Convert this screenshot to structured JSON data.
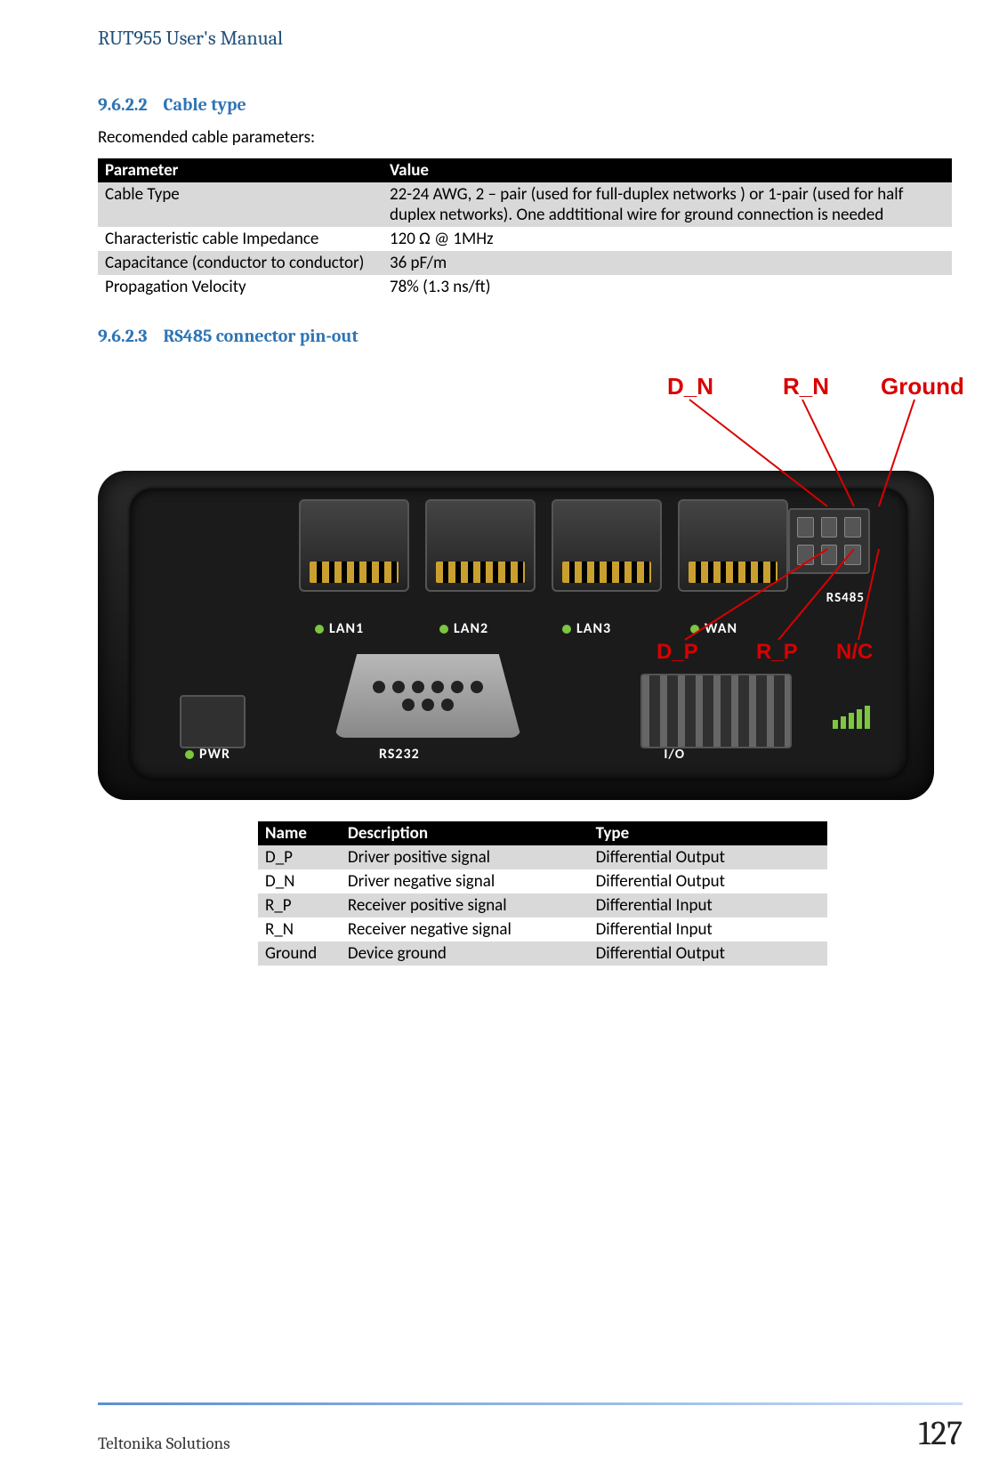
{
  "header": {
    "title": "RUT955 User's Manual"
  },
  "section1": {
    "number": "9.6.2.2",
    "title": "Cable type",
    "intro": "Recomended cable parameters:",
    "table": {
      "headers": [
        "Parameter",
        "Value"
      ],
      "rows": [
        {
          "p": "Cable Type",
          "v": "22-24 AWG, 2 – pair (used for full-duplex networks ) or 1-pair (used for half duplex networks). One addtitional wire for ground connection is needed"
        },
        {
          "p": "Characteristic cable Impedance",
          "v": "120 Ω @ 1MHz"
        },
        {
          "p": "Capacitance (conductor to conductor)",
          "v": "36 pF/m"
        },
        {
          "p": "Propagation Velocity",
          "v": "78% (1.3 ns/ft)"
        }
      ]
    }
  },
  "section2": {
    "number": "9.6.2.3",
    "title": "RS485 connector pin-out",
    "deviceLabels": {
      "lan1": "LAN1",
      "lan2": "LAN2",
      "lan3": "LAN3",
      "wan": "WAN",
      "rs485": "RS485",
      "pwr": "PWR",
      "rs232": "RS232",
      "io": "I/O"
    },
    "callouts": {
      "dn": "D_N",
      "rn": "R_N",
      "gnd": "Ground",
      "dp": "D_P",
      "rp": "R_P",
      "nc": "N/C"
    },
    "pinoutTable": {
      "headers": [
        "Name",
        "Description",
        "Type"
      ],
      "rows": [
        {
          "n": "D_P",
          "d": "Driver positive signal",
          "t": "Differential Output"
        },
        {
          "n": "D_N",
          "d": "Driver negative signal",
          "t": "Differential Output"
        },
        {
          "n": "R_P",
          "d": "Receiver positive signal",
          "t": "Differential Input"
        },
        {
          "n": "R_N",
          "d": "Receiver negative signal",
          "t": "Differential Input"
        },
        {
          "n": "Ground",
          "d": "Device ground",
          "t": "Differential Output"
        }
      ]
    }
  },
  "footer": {
    "company": "Teltonika Solutions",
    "page": "127"
  }
}
